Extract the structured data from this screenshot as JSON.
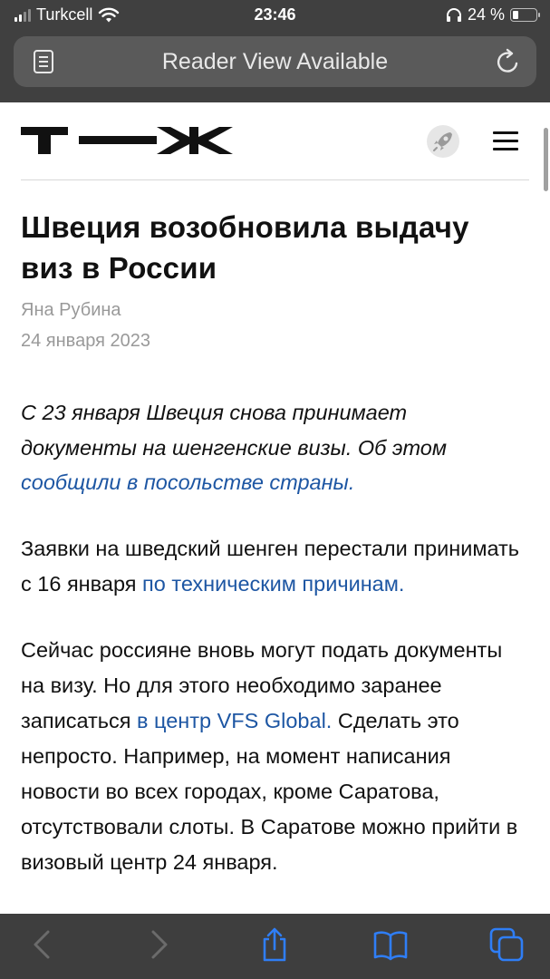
{
  "status_bar": {
    "carrier": "Turkcell",
    "time": "23:46",
    "battery": "24 %",
    "battery_level": 0.24
  },
  "address_bar": {
    "text": "Reader View Available"
  },
  "site": {
    "logo_text": "Т—Ж"
  },
  "article": {
    "title": "Швеция возобновила выдачу виз в России",
    "author": "Яна Рубина",
    "date": "24 января 2023",
    "lead": {
      "text_before": "С 23 января Швеция снова принимает документы на шенгенские визы. Об этом ",
      "link": "сообщили в посольстве страны."
    },
    "para1": {
      "text_before": "Заявки на шведский шенген перестали принимать с 16 января ",
      "link": "по техническим причинам."
    },
    "para2": {
      "text_before": "Сейчас россияне вновь могут подать документы на визу. Но для этого необходимо заранее записаться ",
      "link": "в центр VFS Global.",
      "text_after": " Сделать это непросто. Например, на момент написания новости во всех городах, кроме Саратова, отсутствовали слоты. В Саратове можно прийти в визовый центр 24 января."
    }
  },
  "colors": {
    "link": "#1d56a3",
    "chrome": "#404040",
    "toolbar_active": "#2f7ef6",
    "toolbar_disabled": "#6b6b6b"
  },
  "icons": {
    "reader": "reader-view-icon",
    "reload": "reload-icon",
    "rocket": "rocket-icon",
    "menu": "hamburger-menu-icon",
    "back": "chevron-left-icon",
    "forward": "chevron-right-icon",
    "share": "share-icon",
    "bookmarks": "book-icon",
    "tabs": "tabs-icon"
  }
}
